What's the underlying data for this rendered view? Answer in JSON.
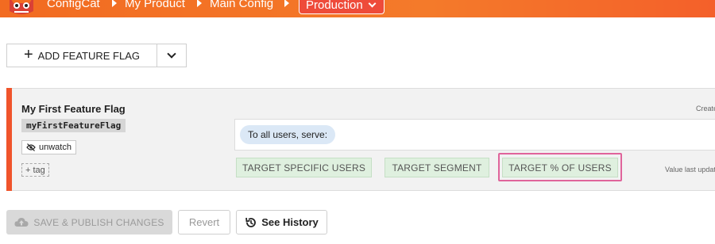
{
  "header": {
    "breadcrumbs": [
      "ConfigCat",
      "My Product",
      "Main Config"
    ],
    "environment": "Production",
    "icons": {
      "logo": "configcat-logo",
      "separator": "caret-right-icon",
      "env_caret": "chevron-down-icon"
    },
    "colors": {
      "header_start": "#f26b21",
      "header_end": "#f4602a"
    }
  },
  "toolbar": {
    "add_label": "ADD FEATURE FLAG",
    "icons": {
      "plus": "plus-icon",
      "dropdown": "chevron-down-icon"
    }
  },
  "flag": {
    "name": "My First Feature Flag",
    "key": "myFirstFeatureFlag",
    "unwatch_label": "unwatch",
    "tag_label": "+ tag",
    "created_text": "Create",
    "updated_text": "Value last updat",
    "serve_label": "To all users, serve:",
    "targets": [
      "TARGET SPECIFIC USERS",
      "TARGET SEGMENT",
      "TARGET % OF USERS"
    ],
    "accent_color": "#f0542b",
    "icons": {
      "unwatch": "eye-slash-icon"
    }
  },
  "actions": {
    "save_label": "SAVE & PUBLISH CHANGES",
    "revert_label": "Revert",
    "history_label": "See History",
    "icons": {
      "save": "cloud-upload-icon",
      "history": "history-icon"
    }
  }
}
